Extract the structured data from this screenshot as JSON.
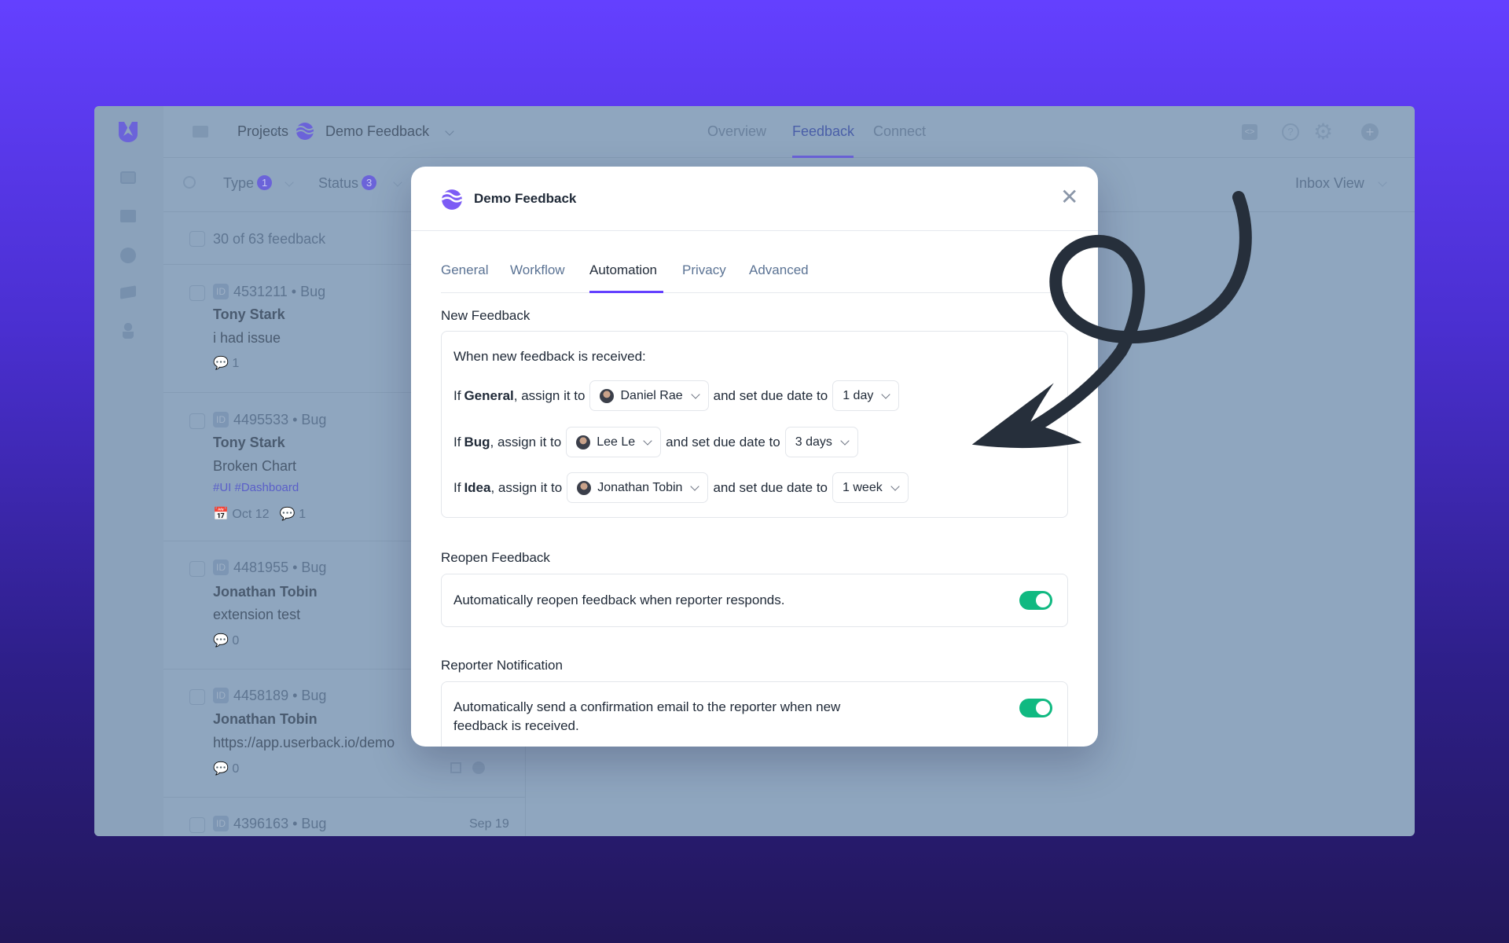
{
  "colors": {
    "accent": "#6440ff",
    "toggle_on": "#10b981",
    "tag": "#6b63d9"
  },
  "header": {
    "breadcrumb_root": "Projects",
    "project": "Demo Feedback",
    "tabs": [
      "Overview",
      "Feedback",
      "Connect"
    ],
    "active_tab": "Feedback",
    "icons": [
      "code-icon",
      "help-icon",
      "gear-icon",
      "plus-circle-icon"
    ]
  },
  "filters": {
    "type_label": "Type",
    "type_count": "1",
    "status_label": "Status",
    "status_count": "3",
    "view": "Inbox View"
  },
  "list": {
    "count": "30 of 63 feedback",
    "items": [
      {
        "id": "4531211",
        "type": "Bug",
        "name": "Tony Stark",
        "text": "i had issue",
        "comments": "1"
      },
      {
        "id": "4495533",
        "type": "Bug",
        "name": "Tony Stark",
        "text": "Broken Chart",
        "tags": "#UI  #Dashboard",
        "date": "Oct 12",
        "comments": "1"
      },
      {
        "id": "4481955",
        "type": "Bug",
        "name": "Jonathan Tobin",
        "text": "extension test",
        "comments": "0"
      },
      {
        "id": "4458189",
        "type": "Bug",
        "name": "Jonathan Tobin",
        "text": "https://app.userback.io/demo",
        "comments": "0"
      },
      {
        "id": "4396163",
        "type": "Bug",
        "date": "Sep 19"
      }
    ]
  },
  "modal": {
    "title": "Demo Feedback",
    "tabs": [
      "General",
      "Workflow",
      "Automation",
      "Privacy",
      "Advanced"
    ],
    "active_tab": "Automation",
    "new_feedback": {
      "heading": "New Feedback",
      "intro": "When new feedback is received:",
      "if": "If",
      "assign": ", assign it to",
      "due": "and set due date to",
      "rules": [
        {
          "type": "General",
          "assignee": "Daniel Rae",
          "due": "1 day"
        },
        {
          "type": "Bug",
          "assignee": "Lee Le",
          "due": "3 days"
        },
        {
          "type": "Idea",
          "assignee": "Jonathan Tobin",
          "due": "1 week"
        }
      ]
    },
    "reopen": {
      "heading": "Reopen Feedback",
      "text": "Automatically reopen feedback when reporter responds.",
      "enabled": true
    },
    "notify": {
      "heading": "Reporter Notification",
      "text1": "Automatically send a confirmation email to the reporter when new",
      "text2": "feedback is received.",
      "enabled": true
    }
  }
}
